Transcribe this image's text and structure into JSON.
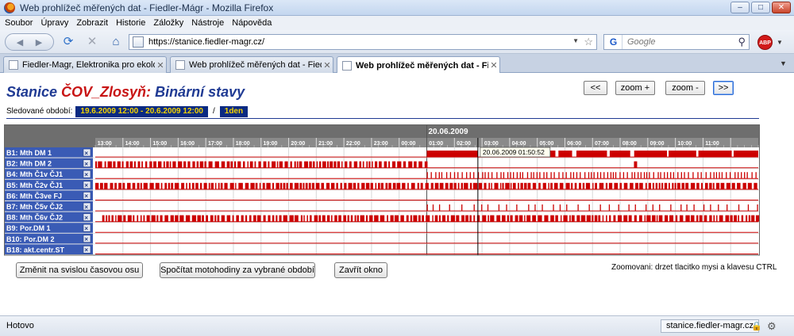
{
  "window": {
    "title": "Web prohlížeč měřených dat - Fiedler-Mágr - Mozilla Firefox"
  },
  "menu": [
    "Soubor",
    "Úpravy",
    "Zobrazit",
    "Historie",
    "Záložky",
    "Nástroje",
    "Nápověda"
  ],
  "nav": {
    "url": "https://stanice.fiedler-magr.cz/",
    "search_placeholder": "Google",
    "search_logo": "G",
    "abp_label": "ABP"
  },
  "tabs": [
    {
      "label": "Fiedler-Magr, Elektronika pro ekologii",
      "active": false
    },
    {
      "label": "Web prohlížeč měřených dat - Fiedl...",
      "active": false
    },
    {
      "label": "Web prohlížeč měřených dat - Fie...",
      "active": true
    }
  ],
  "page": {
    "title_prefix": "Stanice ",
    "station": "ČOV_Zlosyň:",
    "title_suffix": " Binární stavy",
    "period_label": "Sledované období:",
    "period_range": "19.6.2009 12:00 - 20.6.2009 12:00",
    "period_sep": "/",
    "period_length": "1den",
    "controls": {
      "prev": "<<",
      "zoom_in": "zoom +",
      "zoom_out": "zoom -",
      "next": ">>"
    },
    "buttons": {
      "toggle_axis": "Změnit na svislou časovou osu",
      "calc_hours": "Spočítat motohodiny za vybrané období",
      "close_window": "Zavřít okno"
    },
    "zoom_hint": "Zoomovani: drzet tlacitko mysi a klavesu CTRL"
  },
  "chart_data": {
    "type": "timeline",
    "date_label": "20.06.2009",
    "time_ticks": [
      "13:00",
      "14:00",
      "15:00",
      "16:00",
      "17:00",
      "18:00",
      "19:00",
      "20:00",
      "21:00",
      "22:00",
      "23:00",
      "00:00",
      "01:00",
      "02:00",
      "03:00",
      "04:00",
      "05:00",
      "06:00",
      "07:00",
      "08:00",
      "09:00",
      "10:00",
      "11:00"
    ],
    "range_hours": [
      12,
      36
    ],
    "cursor": {
      "hours": 25.85,
      "label": "20.06.2009 01:50:52"
    },
    "series": [
      {
        "name": "B1: Mth DM 1",
        "pattern": "solid_from",
        "from": 24,
        "to": 36,
        "gap": 1.85
      },
      {
        "name": "B2: Mth DM 2",
        "pattern": "dense",
        "from": 12,
        "to": 24,
        "extra": 31.5
      },
      {
        "name": "B4: Mth Č1v ČJ1",
        "pattern": "ticks",
        "from": 24,
        "to": 36,
        "step": 0.12
      },
      {
        "name": "B5: Mth Č2v ČJ1",
        "pattern": "dense",
        "from": 12,
        "to": 36
      },
      {
        "name": "B6: Mth Č3ve FJ",
        "pattern": "empty"
      },
      {
        "name": "B7: Mth Č5v ČJ2",
        "pattern": "ticks",
        "from": 24,
        "to": 36,
        "step": 0.3
      },
      {
        "name": "B8: Mth Č6v ČJ2",
        "pattern": "dense",
        "from": 12.25,
        "to": 36
      },
      {
        "name": "B9: Por.DM 1",
        "pattern": "empty"
      },
      {
        "name": "B10: Por.DM 2",
        "pattern": "empty"
      },
      {
        "name": "B18: akt.centr.ST",
        "pattern": "empty"
      }
    ],
    "colors": {
      "signal": "#cc0000",
      "label_bg": "#3a5bb5",
      "header_bg": "#6e6e6e"
    }
  },
  "status": {
    "text": "Hotovo",
    "domain": "stanice.fiedler-magr.cz"
  }
}
